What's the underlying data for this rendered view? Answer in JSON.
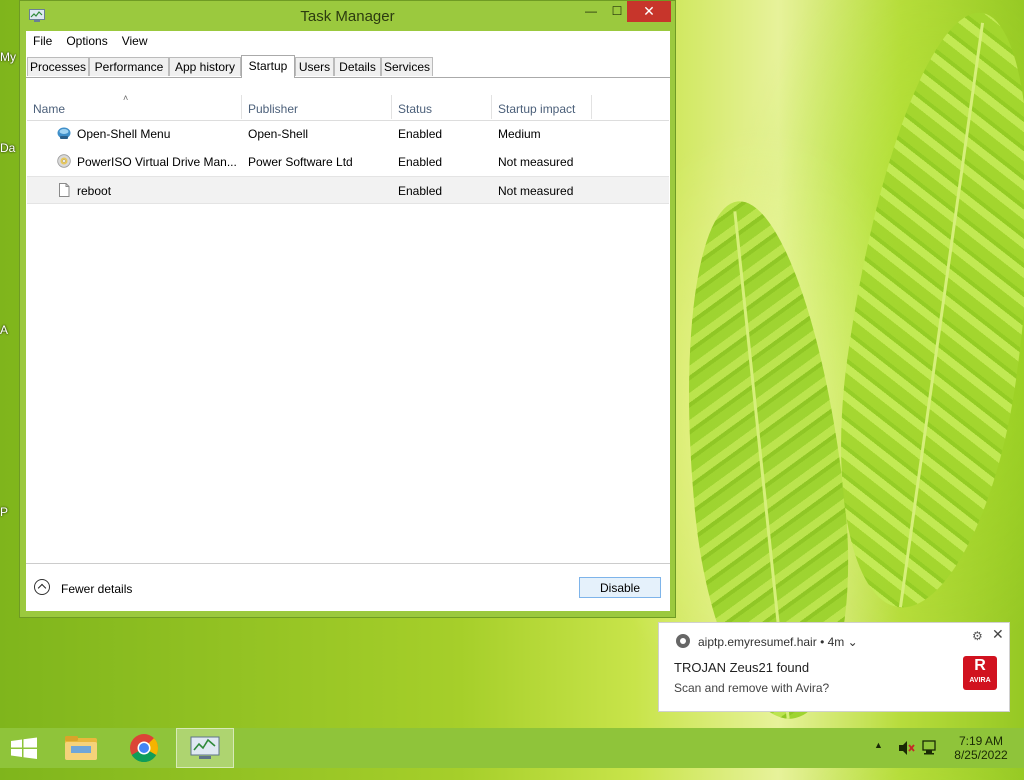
{
  "desktop": {
    "fragments": [
      "My",
      "Da",
      "A",
      "P"
    ]
  },
  "window": {
    "title": "Task Manager",
    "controls": {
      "minimize": "—",
      "maximize": "☐",
      "close": "✕"
    }
  },
  "menu": {
    "items": [
      "File",
      "Options",
      "View"
    ]
  },
  "tabs": [
    "Processes",
    "Performance",
    "App history",
    "Startup",
    "Users",
    "Details",
    "Services"
  ],
  "active_tab": "Startup",
  "table": {
    "sort_indicator": "˄",
    "columns": [
      "Name",
      "Publisher",
      "Status",
      "Startup impact"
    ],
    "rows": [
      {
        "icon": "open-shell-icon",
        "name": "Open-Shell Menu",
        "publisher": "Open-Shell",
        "status": "Enabled",
        "impact": "Medium"
      },
      {
        "icon": "poweriso-icon",
        "name": "PowerISO Virtual Drive Man...",
        "publisher": "Power Software Ltd",
        "status": "Enabled",
        "impact": "Not measured"
      },
      {
        "icon": "file-icon",
        "name": "reboot",
        "publisher": "",
        "status": "Enabled",
        "impact": "Not measured"
      }
    ]
  },
  "footer": {
    "fewer_details": "Fewer details",
    "disable_button": "Disable"
  },
  "notification": {
    "source": "aiptp.emyresumef.hair",
    "age": "• 4m ⌄",
    "title": "TROJAN Zeus21 found",
    "body": "Scan and remove with Avira?",
    "logo_mark": "R",
    "logo_text": "AVIRA",
    "settings_glyph": "⚙",
    "close_glyph": "✕"
  },
  "taskbar": {
    "time": "7:19 AM",
    "date": "8/25/2022",
    "tray_arrow": "▲"
  },
  "colors": {
    "close_button": "#c7352b",
    "window_frame": "#9bc93e",
    "taskbar": "#8fc43a",
    "avira_red": "#d1121f",
    "header_text": "#4c607a"
  }
}
